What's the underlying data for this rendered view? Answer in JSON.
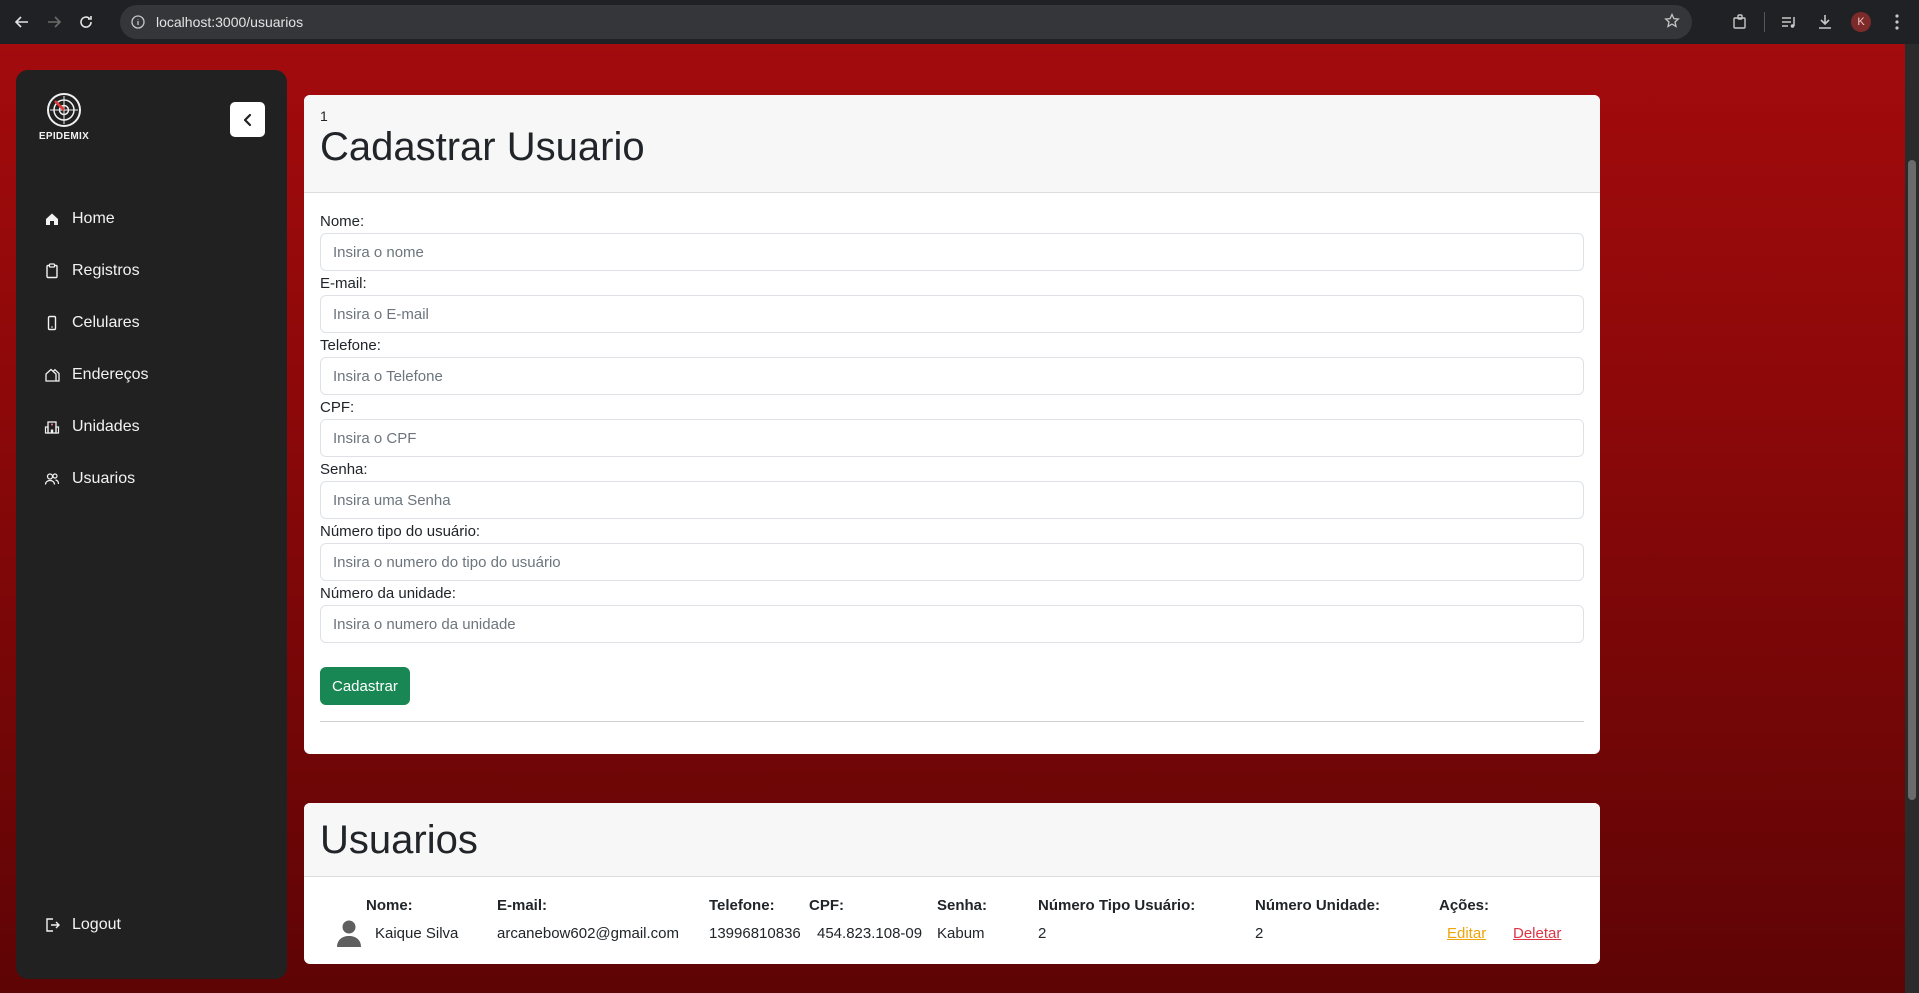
{
  "browser": {
    "url": "localhost:3000/usuarios",
    "profile_initial": "K"
  },
  "sidebar": {
    "logo_text": "EPIDEMIX",
    "items": [
      {
        "label": "Home",
        "icon": "home-icon"
      },
      {
        "label": "Registros",
        "icon": "clipboard-icon"
      },
      {
        "label": "Celulares",
        "icon": "phone-icon"
      },
      {
        "label": "Endereços",
        "icon": "address-icon"
      },
      {
        "label": "Unidades",
        "icon": "building-icon"
      },
      {
        "label": "Usuarios",
        "icon": "users-icon"
      }
    ],
    "logout_label": "Logout"
  },
  "form_card": {
    "counter": "1",
    "title": "Cadastrar Usuario",
    "fields": [
      {
        "label": "Nome:",
        "placeholder": "Insira o nome",
        "value": ""
      },
      {
        "label": "E-mail:",
        "placeholder": "Insira o E-mail",
        "value": ""
      },
      {
        "label": "Telefone:",
        "placeholder": "Insira o Telefone",
        "value": ""
      },
      {
        "label": "CPF:",
        "placeholder": "Insira o CPF",
        "value": ""
      },
      {
        "label": "Senha:",
        "placeholder": "Insira uma Senha",
        "value": ""
      },
      {
        "label": "Número tipo do usuário:",
        "placeholder": "Insira o numero do tipo do usuário",
        "value": ""
      },
      {
        "label": "Número da unidade:",
        "placeholder": "Insira o numero da unidade",
        "value": ""
      }
    ],
    "submit_label": "Cadastrar"
  },
  "list_card": {
    "title": "Usuarios",
    "columns": [
      "Nome:",
      "E-mail:",
      "Telefone:",
      "CPF:",
      "Senha:",
      "Número Tipo Usuário:",
      "Número Unidade:",
      "Ações:"
    ],
    "rows": [
      {
        "nome": "Kaique Silva",
        "email": "arcanebow602@gmail.com",
        "telefone": "13996810836",
        "cpf": "454.823.108-09",
        "senha": "Kabum",
        "tipo": "2",
        "unidade": "2",
        "edit_label": "Editar",
        "delete_label": "Deletar"
      }
    ]
  },
  "colors": {
    "accent_red": "#a30b0d",
    "sidebar_bg": "#212121",
    "success": "#198754",
    "warning_link": "#f0a30a",
    "danger_link": "#dc3545"
  }
}
